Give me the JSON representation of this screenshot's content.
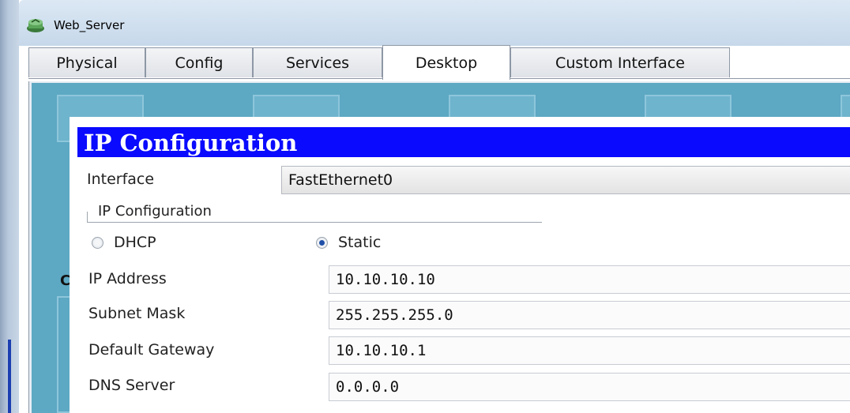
{
  "window": {
    "title": "Web_Server",
    "icon": "router-app-icon"
  },
  "tabs": [
    {
      "label": "Physical",
      "active": false
    },
    {
      "label": "Config",
      "active": false
    },
    {
      "label": "Services",
      "active": false
    },
    {
      "label": "Desktop",
      "active": true
    },
    {
      "label": "Custom Interface",
      "active": false
    }
  ],
  "ip_config": {
    "header_title": "IP Configuration",
    "interface_label": "Interface",
    "interface_value": "FastEthernet0",
    "group_legend": "IP Configuration",
    "dhcp_label": "DHCP",
    "static_label": "Static",
    "mode_selected": "Static",
    "ip_address_label": "IP Address",
    "ip_address_value": "10.10.10.10",
    "subnet_mask_label": "Subnet Mask",
    "subnet_mask_value": "255.255.255.0",
    "default_gateway_label": "Default Gateway",
    "default_gateway_value": "10.10.10.1",
    "dns_server_label": "DNS Server",
    "dns_server_value": "0.0.0.0"
  },
  "desktop": {
    "partial_label": "C"
  },
  "colors": {
    "header_blue": "#0a0afe",
    "desktop_teal": "#5da8c3"
  }
}
